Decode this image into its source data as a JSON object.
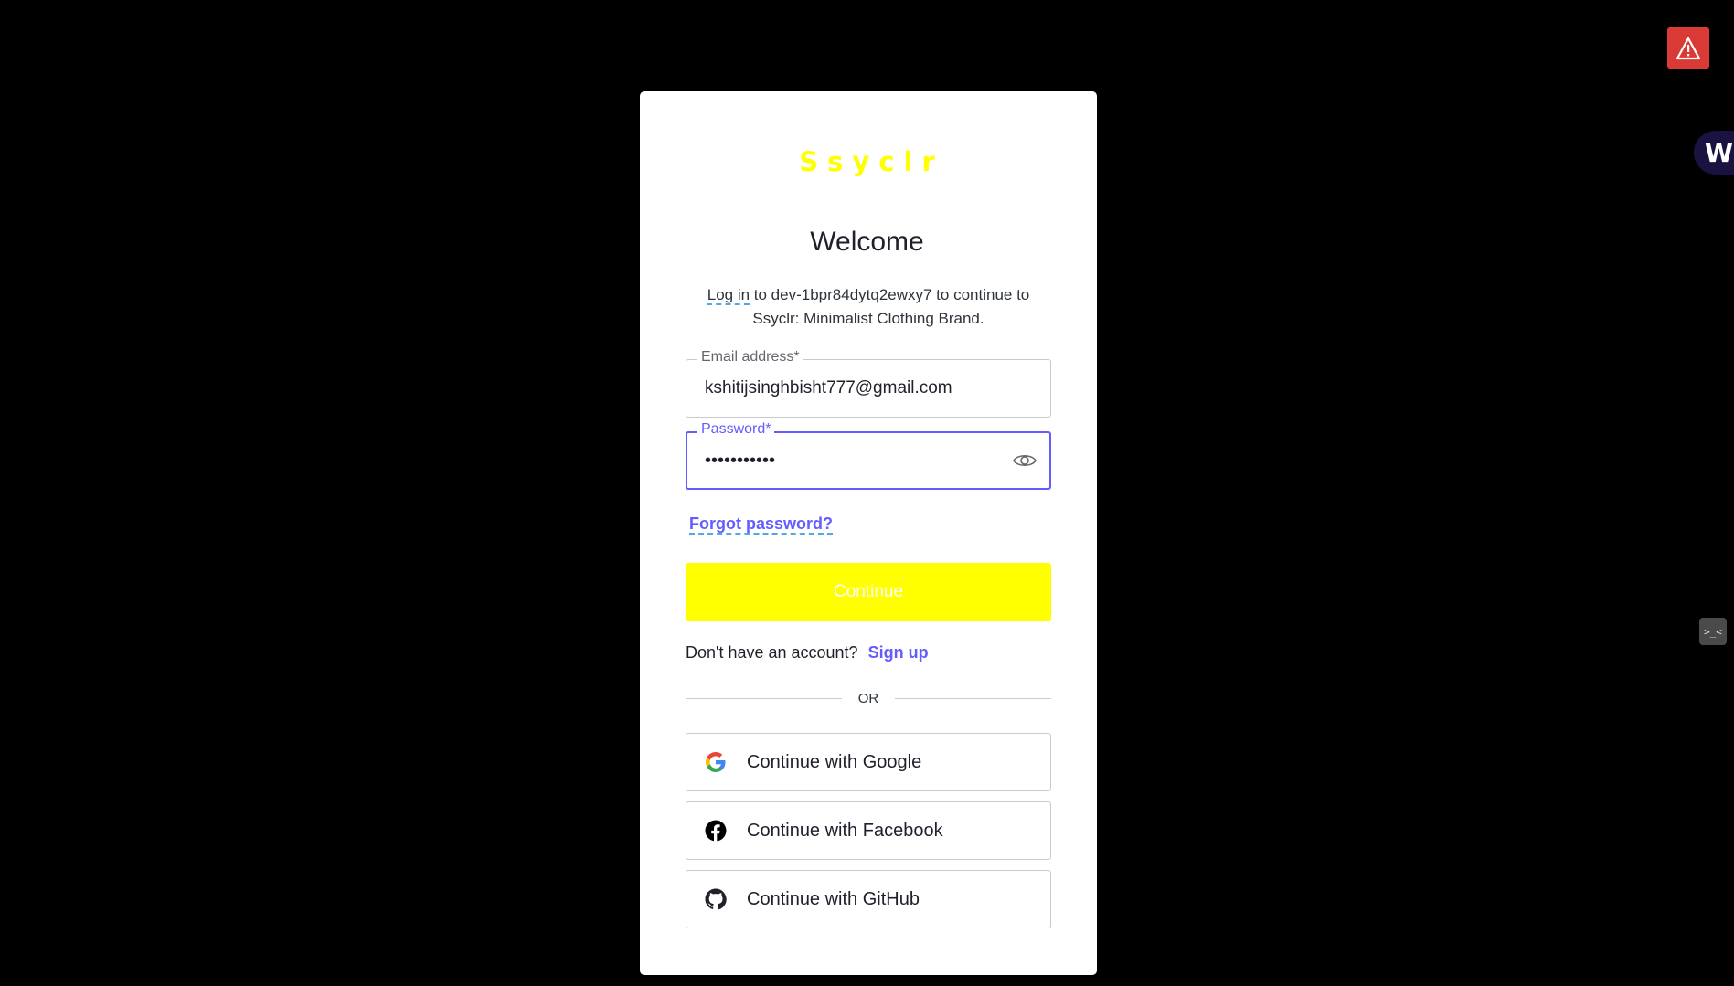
{
  "brand": {
    "logo_text": "Ssyclr"
  },
  "header": {
    "title": "Welcome",
    "subtitle_link": "Log in",
    "subtitle_rest": " to dev-1bpr84dytq2ewxy7 to continue to Ssyclr: Minimalist Clothing Brand."
  },
  "form": {
    "email": {
      "label": "Email address*",
      "value": "kshitijsinghbisht777@gmail.com"
    },
    "password": {
      "label": "Password*",
      "value": "•••••••••••"
    },
    "forgot_label": "Forgot password?",
    "continue_label": "Continue"
  },
  "signup": {
    "prompt": "Don't have an account?",
    "link": "Sign up"
  },
  "divider": {
    "label": "OR"
  },
  "social": [
    {
      "label": "Continue with Google",
      "icon": "google-icon"
    },
    {
      "label": "Continue with Facebook",
      "icon": "facebook-icon"
    },
    {
      "label": "Continue with GitHub",
      "icon": "github-icon"
    }
  ],
  "overlays": {
    "side_tab_letter": "W",
    "dev_tool_glyph": ">_<"
  },
  "colors": {
    "background": "#000000",
    "accent_yellow": "#ffff00",
    "link_purple": "#635dff",
    "warning_red": "#d93a35"
  }
}
